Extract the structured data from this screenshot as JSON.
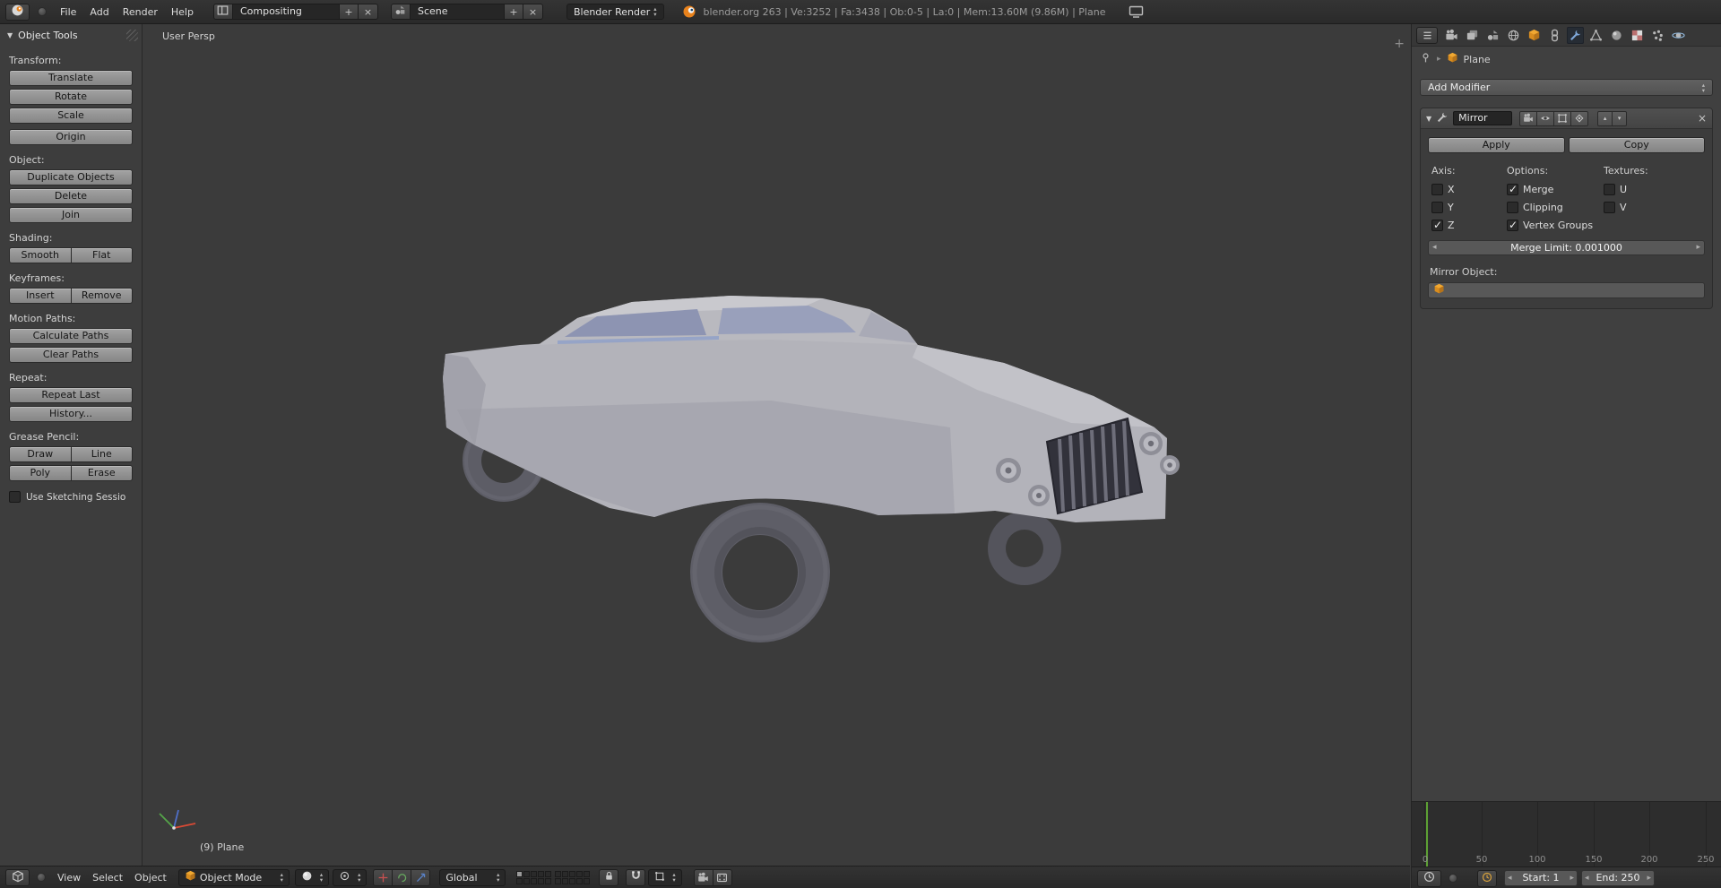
{
  "colors": {
    "object_accent_orange": "#e8941a",
    "active_tab_blue": "#7fa8d9",
    "current_frame_green": "#5da033",
    "window_accent": "#ff9933"
  },
  "top_bar": {
    "menu_file": "File",
    "menu_add": "Add",
    "menu_render": "Render",
    "menu_help": "Help",
    "layout_value": "Compositing",
    "scene_value": "Scene",
    "engine_value": "Blender Render",
    "stats": "blender.org 263 | Ve:3252 | Fa:3438 | Ob:0-5 | La:0 | Mem:13.60M (9.86M) | Plane"
  },
  "tool_shelf": {
    "title": "Object Tools",
    "sections": {
      "transform": "Transform:",
      "object": "Object:",
      "shading": "Shading:",
      "keyframes": "Keyframes:",
      "motion_paths": "Motion Paths:",
      "repeat": "Repeat:",
      "grease_pencil": "Grease Pencil:"
    },
    "buttons": {
      "translate": "Translate",
      "rotate": "Rotate",
      "scale": "Scale",
      "origin": "Origin",
      "duplicate": "Duplicate Objects",
      "delete": "Delete",
      "join": "Join",
      "smooth": "Smooth",
      "flat": "Flat",
      "insert": "Insert",
      "remove": "Remove",
      "calculate_paths": "Calculate Paths",
      "clear_paths": "Clear Paths",
      "repeat_last": "Repeat Last",
      "history": "History...",
      "draw": "Draw",
      "line": "Line",
      "poly": "Poly",
      "erase": "Erase"
    },
    "use_sketching": "Use Sketching Sessio"
  },
  "viewport": {
    "view_label": "User Persp",
    "object_info": "(9) Plane",
    "header": {
      "menu_view": "View",
      "menu_select": "Select",
      "menu_object": "Object",
      "mode_value": "Object Mode",
      "orientation_value": "Global"
    }
  },
  "properties": {
    "breadcrumb_object": "Plane",
    "add_modifier_label": "Add Modifier",
    "modifier": {
      "name_value": "Mirror",
      "apply_label": "Apply",
      "copy_label": "Copy",
      "axis_label": "Axis:",
      "options_label": "Options:",
      "textures_label": "Textures:",
      "axis_x": "X",
      "axis_y": "Y",
      "axis_z": "Z",
      "opt_merge": "Merge",
      "opt_clipping": "Clipping",
      "opt_vertex_groups": "Vertex Groups",
      "tex_u": "U",
      "tex_v": "V",
      "checked": {
        "axis_x": false,
        "axis_y": false,
        "axis_z": true,
        "merge": true,
        "clipping": false,
        "vertex_groups": true,
        "u": false,
        "v": false
      },
      "merge_limit_label": "Merge Limit: 0.001000",
      "mirror_object_label": "Mirror Object:"
    }
  },
  "timeline": {
    "ticks": [
      "0",
      "50",
      "100",
      "150",
      "200",
      "250"
    ],
    "start_value": "Start: 1",
    "end_value": "End: 250"
  }
}
